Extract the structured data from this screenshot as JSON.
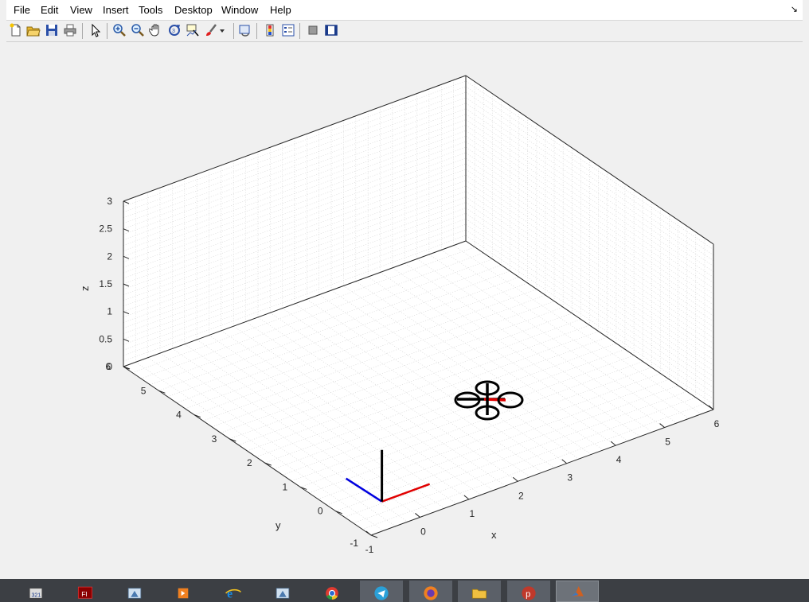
{
  "menu": {
    "items": [
      "File",
      "Edit",
      "View",
      "Insert",
      "Tools",
      "Desktop",
      "Window",
      "Help"
    ]
  },
  "toolbar": {
    "buttons": [
      {
        "name": "new-figure-icon"
      },
      {
        "name": "open-file-icon"
      },
      {
        "name": "save-icon"
      },
      {
        "name": "print-icon"
      },
      {
        "name": "edit-plot-arrow-icon"
      },
      {
        "name": "zoom-in-icon"
      },
      {
        "name": "zoom-out-icon"
      },
      {
        "name": "pan-hand-icon"
      },
      {
        "name": "rotate-3d-icon"
      },
      {
        "name": "data-cursor-icon"
      },
      {
        "name": "brush-icon"
      },
      {
        "name": "link-plot-icon"
      },
      {
        "name": "insert-colorbar-icon"
      },
      {
        "name": "insert-legend-icon"
      },
      {
        "name": "hide-plot-tools-icon"
      },
      {
        "name": "show-plot-tools-icon"
      }
    ]
  },
  "plot": {
    "z_label": "z",
    "x_label": "x",
    "y_label": "y",
    "z_ticks": [
      "0",
      "0.5",
      "1",
      "1.5",
      "2",
      "2.5",
      "3"
    ],
    "x_ticks": [
      "-1",
      "0",
      "1",
      "2",
      "3",
      "4",
      "5",
      "6"
    ],
    "y_ticks": [
      "-1",
      "0",
      "1",
      "2",
      "3",
      "4",
      "5",
      "6"
    ],
    "colors": {
      "x_axis_frame": "#e00000",
      "y_axis_frame": "#0000e0",
      "z_axis_frame": "#000000",
      "quad_arm_x": "#e00000",
      "quad_body": "#000000"
    }
  },
  "taskbar": {
    "apps": [
      {
        "name": "media-player-classic-icon",
        "state": "normal"
      },
      {
        "name": "adobe-flash-icon",
        "state": "normal"
      },
      {
        "name": "matlab-app-icon",
        "state": "normal"
      },
      {
        "name": "media-player-icon",
        "state": "normal"
      },
      {
        "name": "internet-explorer-icon",
        "state": "normal"
      },
      {
        "name": "matlab-app-icon-2",
        "state": "normal"
      },
      {
        "name": "chrome-icon",
        "state": "normal"
      },
      {
        "name": "telegram-icon",
        "state": "active"
      },
      {
        "name": "firefox-icon",
        "state": "active"
      },
      {
        "name": "file-explorer-icon",
        "state": "active"
      },
      {
        "name": "psiphon-icon",
        "state": "active"
      },
      {
        "name": "matlab-icon",
        "state": "pressed"
      }
    ]
  }
}
